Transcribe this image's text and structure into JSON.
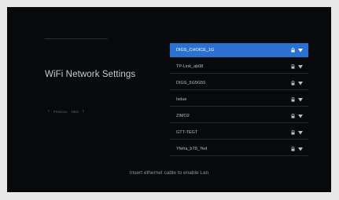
{
  "header": {
    "title": "WiFi Network Settings"
  },
  "hint": {
    "left_glyph": "‹",
    "previous_label": "Previous",
    "next_label": "Next",
    "right_glyph": "›"
  },
  "networks": [
    {
      "ssid": "DIGS_CHOICE_1G",
      "selected": true
    },
    {
      "ssid": "TP-Link_ab08",
      "selected": false
    },
    {
      "ssid": "DIGS_5G5G55",
      "selected": false
    },
    {
      "ssid": "Isdue",
      "selected": false
    },
    {
      "ssid": "ZIMO2",
      "selected": false
    },
    {
      "ssid": "GTT-TEGT",
      "selected": false
    },
    {
      "ssid": "Yfeha_bT8_Yed",
      "selected": false
    }
  ],
  "footer": {
    "message": "Insert ethernet cable to enable Lan"
  },
  "colors": {
    "selection": "#2b72d0",
    "background": "#08090b"
  },
  "icons": {
    "lock": "lock-icon",
    "signal": "wifi-signal-icon"
  }
}
